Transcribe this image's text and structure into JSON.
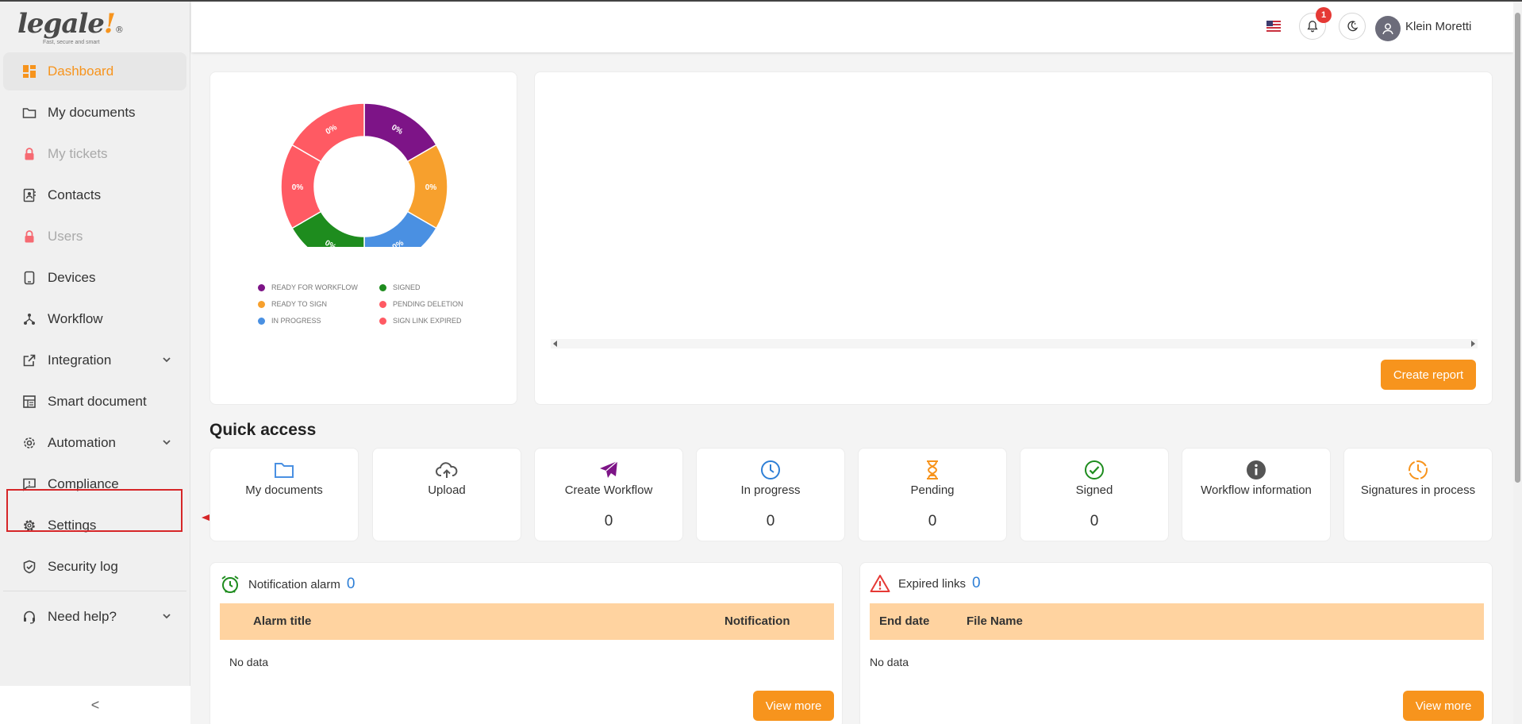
{
  "brand": {
    "name": "legale",
    "bang": "!",
    "reg": "®",
    "tagline": "Fast, secure and smart"
  },
  "sidebar": {
    "items": [
      {
        "label": "Dashboard",
        "icon": "dashboard-icon"
      },
      {
        "label": "My documents",
        "icon": "folder-icon"
      },
      {
        "label": "My tickets",
        "icon": "lock-icon"
      },
      {
        "label": "Contacts",
        "icon": "contacts-icon"
      },
      {
        "label": "Users",
        "icon": "lock-icon"
      },
      {
        "label": "Devices",
        "icon": "device-icon"
      },
      {
        "label": "Workflow",
        "icon": "workflow-icon"
      },
      {
        "label": "Integration",
        "icon": "external-link-icon"
      },
      {
        "label": "Smart document",
        "icon": "smart-document-icon"
      },
      {
        "label": "Automation",
        "icon": "automation-gear-icon"
      },
      {
        "label": "Compliance",
        "icon": "chat-icon"
      },
      {
        "label": "Settings",
        "icon": "gear-icon"
      },
      {
        "label": "Security log",
        "icon": "shield-icon"
      },
      {
        "label": "Need help?",
        "icon": "headset-icon"
      }
    ],
    "collapse_glyph": "<"
  },
  "topbar": {
    "notification_count": "1",
    "username": "Klein Moretti"
  },
  "chart_data": [
    {
      "type": "pie",
      "categories": [
        "READY FOR WORKFLOW",
        "READY TO SIGN",
        "IN PROGRESS",
        "SIGNED",
        "PENDING DELETION",
        "SIGN LINK EXPIRED"
      ],
      "values": [
        0,
        0,
        0,
        0,
        0,
        0
      ],
      "labels": [
        "0%",
        "0%",
        "0%",
        "0%",
        "0%",
        "0%"
      ],
      "colors": [
        "#7d1487",
        "#f7a02d",
        "#4a90e2",
        "#1e8c1e",
        "#ff5a63",
        "#ff5a63"
      ],
      "donut": true
    },
    {
      "type": "bar",
      "categories": [],
      "values": [],
      "y_tick": "0"
    }
  ],
  "report": {
    "button_label": "Create report"
  },
  "quick_access": {
    "title": "Quick access",
    "items": [
      {
        "label": "My documents",
        "count": "",
        "icon": "folder-icon",
        "color": "#4a90e2"
      },
      {
        "label": "Upload",
        "count": "",
        "icon": "cloud-upload-icon",
        "color": "#555555"
      },
      {
        "label": "Create Workflow",
        "count": "0",
        "icon": "paper-plane-icon",
        "color": "#7d1487"
      },
      {
        "label": "In progress",
        "count": "0",
        "icon": "clock-icon",
        "color": "#2e7fd6"
      },
      {
        "label": "Pending",
        "count": "0",
        "icon": "hourglass-icon",
        "color": "#f7941d"
      },
      {
        "label": "Signed",
        "count": "0",
        "icon": "check-circle-icon",
        "color": "#1e8c1e"
      },
      {
        "label": "Workflow information",
        "count": "",
        "icon": "info-icon",
        "color": "#555555"
      },
      {
        "label": "Signatures in process",
        "count": "",
        "icon": "clock-dashed-icon",
        "color": "#f7941d"
      }
    ]
  },
  "alarm_panel": {
    "title": "Notification alarm",
    "count": "0",
    "columns": [
      "Alarm title",
      "Notification"
    ],
    "empty_text": "No data",
    "button_label": "View more"
  },
  "expired_panel": {
    "title": "Expired links",
    "count": "0",
    "columns": [
      "End date",
      "File Name"
    ],
    "empty_text": "No data",
    "button_label": "View more"
  }
}
